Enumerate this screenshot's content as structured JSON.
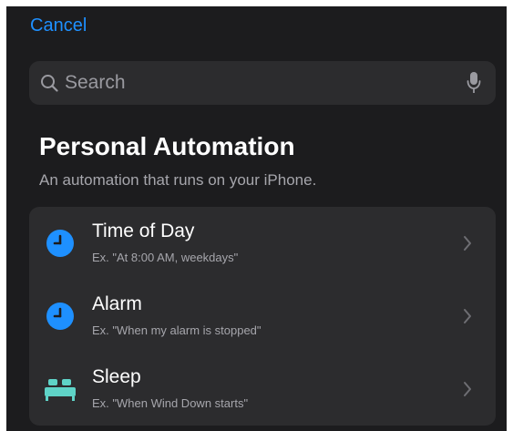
{
  "header": {
    "cancel_label": "Cancel"
  },
  "search": {
    "placeholder": "Search",
    "value": ""
  },
  "section": {
    "title": "Personal Automation",
    "subtitle": "An automation that runs on your iPhone."
  },
  "triggers": [
    {
      "title": "Time of Day",
      "subtitle": "Ex. \"At 8:00 AM, weekdays\"",
      "icon": "clock-icon",
      "icon_color": "#1e90ff"
    },
    {
      "title": "Alarm",
      "subtitle": "Ex. \"When my alarm is stopped\"",
      "icon": "alarm-clock-icon",
      "icon_color": "#1e90ff"
    },
    {
      "title": "Sleep",
      "subtitle": "Ex. \"When Wind Down starts\"",
      "icon": "bed-icon",
      "icon_color": "#5fd3c7"
    }
  ],
  "colors": {
    "accent": "#1e90ff",
    "background": "#1c1c1e",
    "card": "#2c2c2e",
    "secondary_text": "#a6a6ac"
  }
}
